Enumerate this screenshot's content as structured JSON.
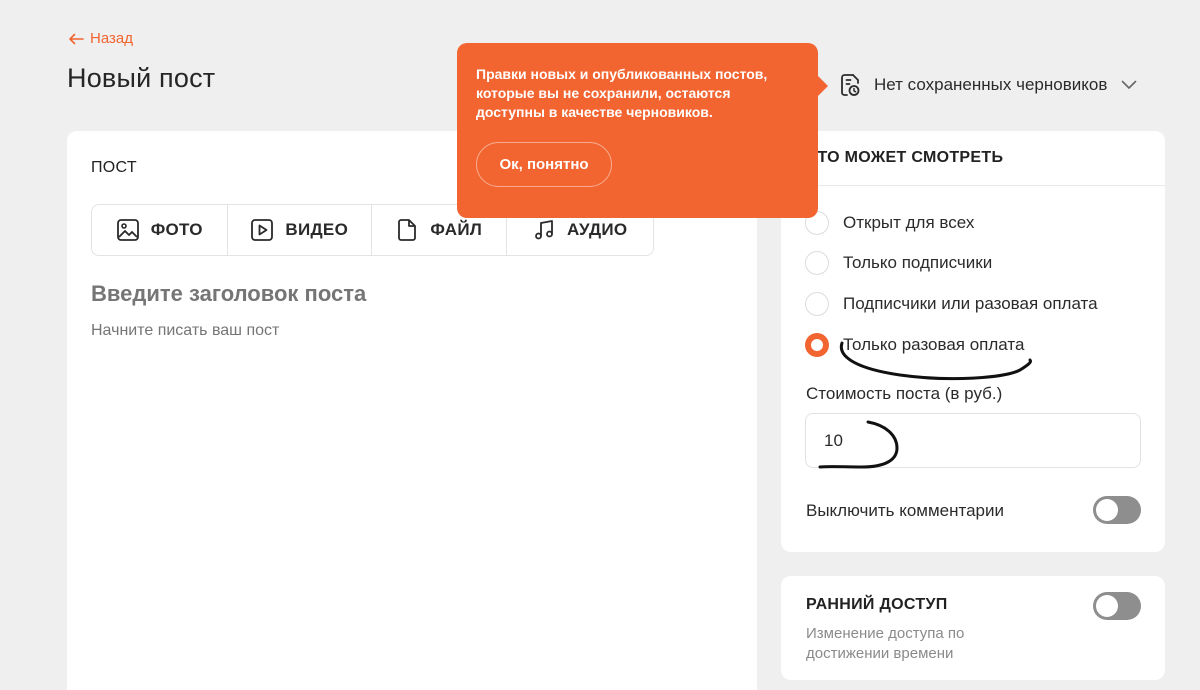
{
  "header": {
    "back_label": "Назад",
    "page_title": "Новый пост",
    "drafts_label": "Нет сохраненных черновиков"
  },
  "post_editor": {
    "section_label": "ПОСТ",
    "media_buttons": [
      {
        "label": "ФОТО",
        "icon": "image-icon"
      },
      {
        "label": "ВИДЕО",
        "icon": "video-icon"
      },
      {
        "label": "ФАЙЛ",
        "icon": "file-icon"
      },
      {
        "label": "АУДИО",
        "icon": "music-note-icon"
      }
    ],
    "title_placeholder": "Введите заголовок поста",
    "body_placeholder": "Начните писать ваш пост"
  },
  "visibility": {
    "header": "КТО МОЖЕТ СМОТРЕТЬ",
    "options": [
      {
        "label": "Открыт для всех",
        "selected": false
      },
      {
        "label": "Только подписчики",
        "selected": false
      },
      {
        "label": "Подписчики или разовая оплата",
        "selected": false
      },
      {
        "label": "Только разовая оплата",
        "selected": true
      }
    ],
    "price_label": "Стоимость поста (в руб.)",
    "price_value": "10",
    "disable_comments_label": "Выключить комментарии",
    "disable_comments_on": false
  },
  "early_access": {
    "title": "РАННИЙ ДОСТУП",
    "description": "Изменение доступа по достижении времени",
    "enabled": false
  },
  "tooltip": {
    "text": "Правки новых и опубликованных постов, которые вы не сохранили, остаются доступны в качестве черновиков.",
    "button_label": "Ок, понятно"
  },
  "colors": {
    "accent": "#f26430",
    "background": "#efefef",
    "panel": "#ffffff",
    "toggle_off": "#8e8e8e"
  }
}
